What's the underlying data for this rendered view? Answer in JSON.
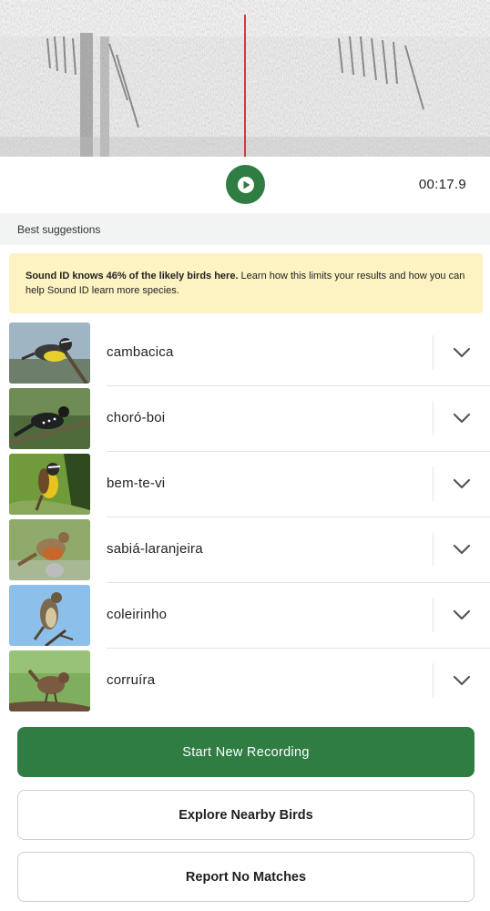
{
  "player": {
    "time": "00:17.9",
    "accent": "#2f7d43",
    "playhead_color": "#d9363e"
  },
  "section": {
    "title": "Best suggestions"
  },
  "banner": {
    "bold": "Sound ID knows 46% of the likely birds here.",
    "text": " Learn how this limits your results and how you can help Sound ID learn more species.",
    "bg": "#fcf2c2"
  },
  "results": [
    {
      "name": "cambacica",
      "icon": "chevron-down-icon"
    },
    {
      "name": "choró-boi",
      "icon": "chevron-down-icon"
    },
    {
      "name": "bem-te-vi",
      "icon": "chevron-down-icon"
    },
    {
      "name": "sabiá-laranjeira",
      "icon": "chevron-down-icon"
    },
    {
      "name": "coleirinho",
      "icon": "chevron-down-icon"
    },
    {
      "name": "corruíra",
      "icon": "chevron-down-icon"
    }
  ],
  "actions": {
    "start": "Start New Recording",
    "explore": "Explore Nearby Birds",
    "report": "Report No Matches"
  }
}
